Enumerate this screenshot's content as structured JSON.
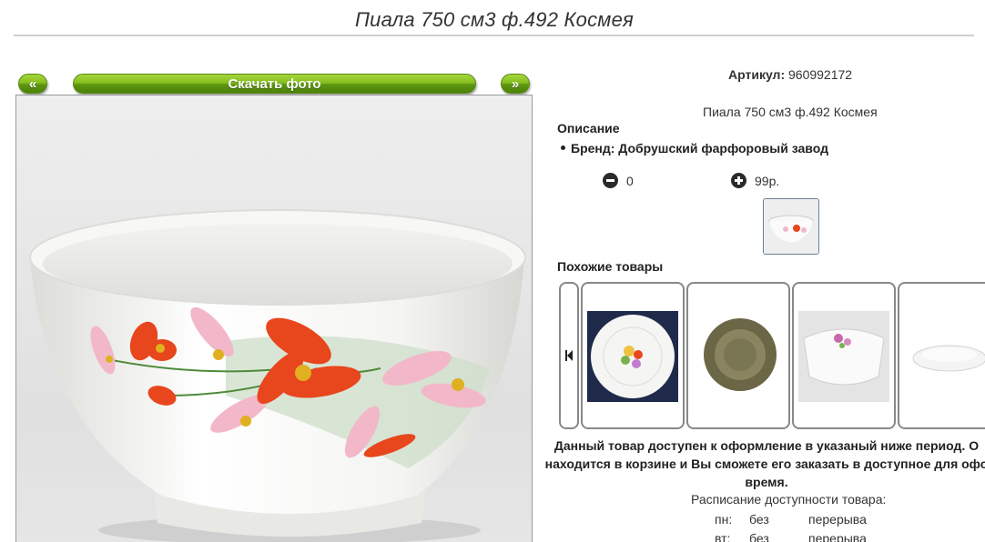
{
  "page": {
    "title": "Пиала 750 см3 ф.492 Космея"
  },
  "buttons": {
    "prev": "«",
    "download": "Скачать фото",
    "next": "»"
  },
  "product": {
    "sku_label": "Артикул:",
    "sku_value": "960992172",
    "name": "Пиала 750 см3 ф.492 Космея",
    "description_heading": "Описание",
    "brand": "Бренд: Добрушский фарфоровый завод",
    "quantity": "0",
    "price": "99р."
  },
  "similar": {
    "heading": "Похожие товары",
    "items": [
      {
        "icon": "plate-with-bouquet"
      },
      {
        "icon": "smoked-glass-plate"
      },
      {
        "icon": "square-bowl-pink-flowers"
      },
      {
        "icon": "white-dish"
      }
    ]
  },
  "notice": {
    "line1": "Данный товар доступен к оформление в указаный ниже период. О",
    "line2": "находится в корзине и Вы сможете его заказать в доступное для офо",
    "line3": "время."
  },
  "schedule": {
    "title": "Расписание доступности товара:",
    "rows": [
      {
        "day": "пн:",
        "a": "без",
        "b": "перерыва"
      },
      {
        "day": "вт:",
        "a": "без",
        "b": "перерыва"
      }
    ]
  },
  "colors": {
    "button_green": "#86be1e",
    "frame_border": "#888888"
  }
}
